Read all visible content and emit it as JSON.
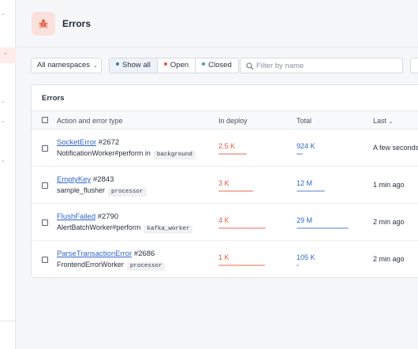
{
  "header": {
    "title": "Errors",
    "icon": "bug-icon"
  },
  "filters": {
    "namespace_label": "All namespaces",
    "status_options": [
      {
        "label": "Show all",
        "color": "#3a7ca5",
        "active": true
      },
      {
        "label": "Open",
        "color": "#e05a3d",
        "active": false
      },
      {
        "label": "Closed",
        "color": "#3aa58a",
        "active": false
      }
    ],
    "search_placeholder": "Filter by name"
  },
  "table": {
    "title": "Errors",
    "columns": {
      "action": "Action and error type",
      "deploy": "In deploy",
      "total": "Total",
      "last": "Last"
    },
    "rows": [
      {
        "error": "SocketError",
        "number": "#2672",
        "action": "NotificationWorker#perform in",
        "namespace": "background",
        "deploy": "2.5 K",
        "deploy_fraction": 0.45,
        "total": "924 K",
        "total_fraction": 0.1,
        "last": "A few seconds ago"
      },
      {
        "error": "EmptyKey",
        "number": "#2843",
        "action": "sample_flusher",
        "namespace": "processor",
        "deploy": "3 K",
        "deploy_fraction": 0.55,
        "total": "12 M",
        "total_fraction": 0.45,
        "last": "1 min ago"
      },
      {
        "error": "FlushFailed",
        "number": "#2790",
        "action": "AlertBatchWorker#perform",
        "namespace": "kafka_worker",
        "deploy": "4 K",
        "deploy_fraction": 0.75,
        "total": "29 M",
        "total_fraction": 0.82,
        "last": "2 min ago"
      },
      {
        "error": "ParseTransactionError",
        "number": "#2686",
        "action": "FrontendErrorWorker",
        "namespace": "processor",
        "deploy": "1 K",
        "deploy_fraction": 0.74,
        "total": "105 K",
        "total_fraction": 0.04,
        "last": "2 min ago"
      }
    ]
  },
  "colors": {
    "deploy": "#e05a3d",
    "deploy_bar": "#f3b5a6",
    "total": "#2f66c8",
    "total_bar": "#a9c0e8",
    "accent_bg": "#fbe1dc"
  }
}
